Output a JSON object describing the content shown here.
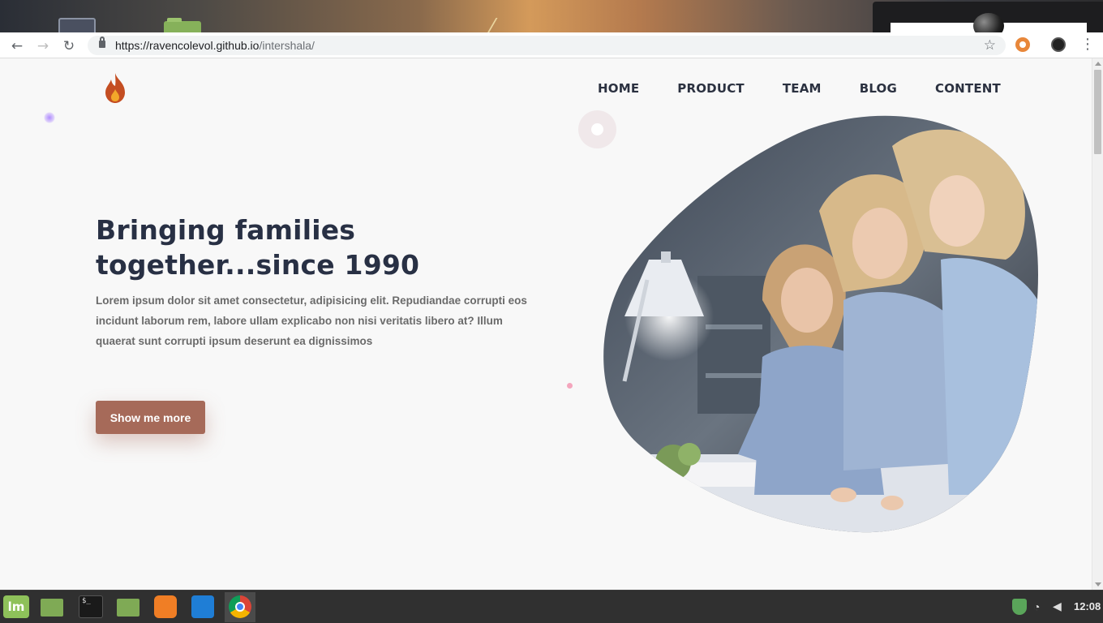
{
  "browser": {
    "url_host": "https://ravencolevol.github.io",
    "url_path": "/intershala/"
  },
  "site": {
    "nav": [
      {
        "label": "HOME"
      },
      {
        "label": "PRODUCT"
      },
      {
        "label": "TEAM"
      },
      {
        "label": "BLOG"
      },
      {
        "label": "CONTENT"
      }
    ],
    "hero": {
      "title_line1": "Bringing families",
      "title_line2": "together...since 1990",
      "text": "Lorem ipsum dolor sit amet consectetur, adipisicing elit. Repudiandae corrupti eos incidunt laborum rem, labore ullam explicabo non nisi veritatis libero at? Illum quaerat sunt corrupti ipsum deserunt ea dignissimos",
      "button_label": "Show me more"
    },
    "colors": {
      "accent": "#a66a59",
      "heading": "#283044",
      "flame_outer": "#c44e22",
      "flame_inner": "#f2a72a"
    }
  },
  "taskbar": {
    "apps": [
      {
        "name": "menu",
        "icon": "mint-menu-icon"
      },
      {
        "name": "files",
        "icon": "folder-icon"
      },
      {
        "name": "terminal",
        "icon": "terminal-icon"
      },
      {
        "name": "files-2",
        "icon": "folder-icon"
      },
      {
        "name": "firefox",
        "icon": "firefox-icon"
      },
      {
        "name": "vscode",
        "icon": "vscode-icon"
      },
      {
        "name": "chrome",
        "icon": "chrome-icon"
      }
    ],
    "clock": "12:08"
  }
}
